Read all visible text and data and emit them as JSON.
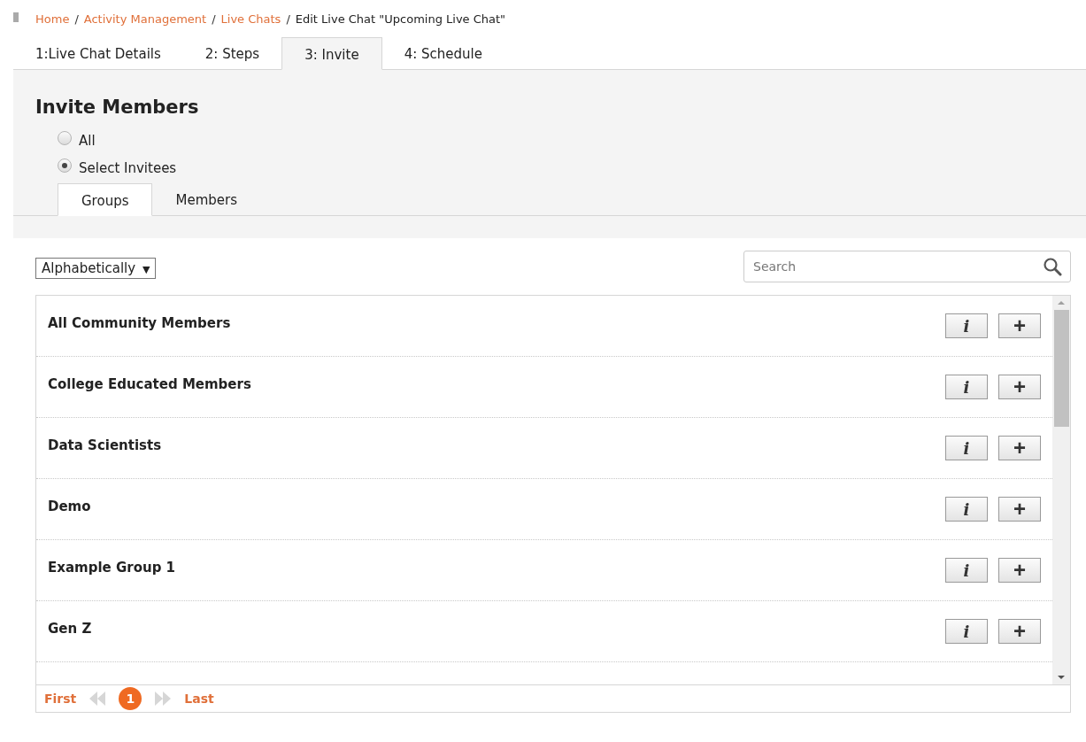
{
  "breadcrumb": [
    {
      "label": "Home",
      "link": true
    },
    {
      "label": "Activity Management",
      "link": true
    },
    {
      "label": "Live Chats",
      "link": true
    },
    {
      "label": "Edit Live Chat \"Upcoming Live Chat\"",
      "link": false
    }
  ],
  "separator": "/",
  "tabs": [
    {
      "label": "1:Live Chat Details",
      "selected": false
    },
    {
      "label": "2: Steps",
      "selected": false
    },
    {
      "label": "3: Invite",
      "selected": true
    },
    {
      "label": "4: Schedule",
      "selected": false
    }
  ],
  "section_title": "Invite Members",
  "radios": [
    {
      "label": "All",
      "selected": false
    },
    {
      "label": "Select Invitees",
      "selected": true
    }
  ],
  "sub_tabs": [
    {
      "label": "Groups",
      "selected": true
    },
    {
      "label": "Members",
      "selected": false
    }
  ],
  "sort_dropdown": {
    "value": "Alphabetically",
    "caret": "▼"
  },
  "search": {
    "placeholder": "Search"
  },
  "groups": [
    {
      "name": "All Community Members",
      "info": "i",
      "add": "+"
    },
    {
      "name": "College Educated Members",
      "info": "i",
      "add": "+"
    },
    {
      "name": "Data Scientists",
      "info": "i",
      "add": "+"
    },
    {
      "name": "Demo",
      "info": "i",
      "add": "+"
    },
    {
      "name": "Example Group 1",
      "info": "i",
      "add": "+"
    },
    {
      "name": "Gen Z",
      "info": "i",
      "add": "+"
    }
  ],
  "pager": {
    "first": "First",
    "last": "Last",
    "pages": [
      {
        "label": "1",
        "selected": true
      }
    ]
  }
}
